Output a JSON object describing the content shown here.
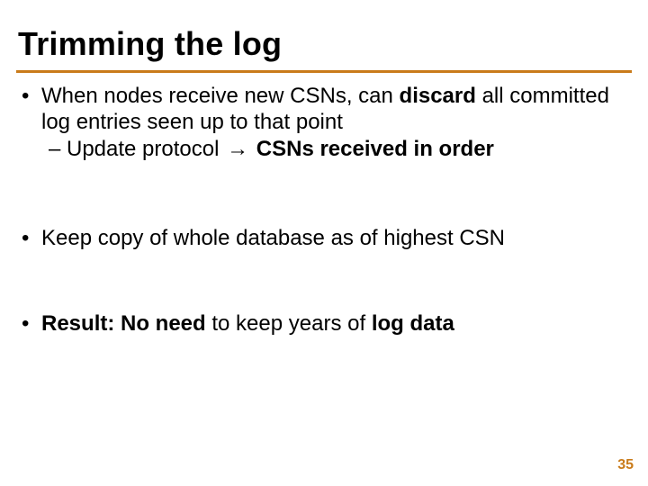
{
  "title": "Trimming the log",
  "bullets": {
    "b1": {
      "pre": "When nodes receive new CSNs, can ",
      "bold1": "discard",
      "post": " all committed log entries seen up to that point",
      "sub": {
        "pre": "Update protocol ",
        "arrow": "→",
        "bold": " CSNs received in order"
      }
    },
    "b2": "Keep copy of whole database as of highest CSN",
    "b3": {
      "bold1": "Result:",
      "mid1": " ",
      "bold2": "No need",
      "mid2": " to keep years of ",
      "bold3": "log data"
    }
  },
  "page": "35"
}
